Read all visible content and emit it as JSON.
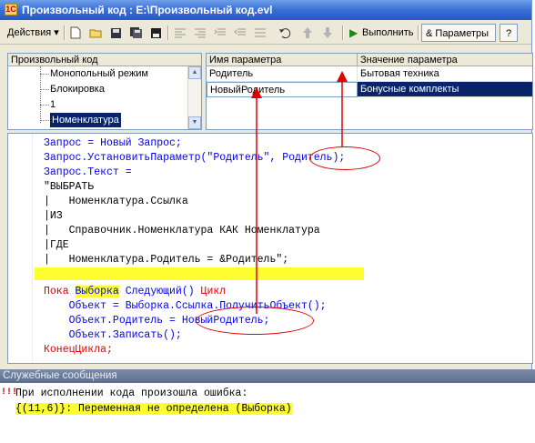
{
  "window": {
    "title": "Произвольный код : E:\\Произвольный код.evl",
    "icon": "1c-app-icon"
  },
  "toolbar": {
    "actions_label": "Действия",
    "actions_arrow": "▾",
    "run_label": "Выполнить",
    "params_label": "Параметры",
    "params_prefix": "&",
    "help_label": "?",
    "icons": [
      "new-doc-icon",
      "open-folder-icon",
      "save-icon",
      "save-all-icon",
      "floppy-icon",
      "align-left-icon",
      "align-right-icon",
      "indent-icon",
      "unindent-icon",
      "list-icon",
      "undo-icon",
      "arrow-up-icon",
      "arrow-down-icon",
      "run-icon"
    ]
  },
  "left_pane": {
    "header": "Произвольный код",
    "items": [
      "Монопольный режим",
      "Блокировка",
      "1",
      "Номенклатура"
    ],
    "selected_index": 3
  },
  "params_grid": {
    "col1": "Имя параметра",
    "col2": "Значение параметра",
    "rows": [
      {
        "name": "Родитель",
        "value": "Бытовая техника"
      },
      {
        "name": "НовыйРодитель",
        "value": "Бонусные комплекты"
      }
    ]
  },
  "code": {
    "l1a": "Запрос = Новый Запрос;",
    "l2a": "Запрос.УстановитьПараметр(\"Родитель\", ",
    "l2b": "Родитель",
    "l2c": ");",
    "l3": "Запрос.Текст =",
    "l4": "\"ВЫБРАТЬ",
    "l5": "|   Номенклатура.Ссылка",
    "l6": "|ИЗ",
    "l7": "|   Справочник.Номенклатура КАК Номенклатура",
    "l8": "|ГДЕ",
    "l9": "|   Номенклатура.Родитель = &Родитель\";",
    "l10a": "Пока ",
    "l10b": "Выборка",
    "l10c": " Следующий()",
    "l10d": " Цикл",
    "l11": "    Объект = Выборка.Ссылка.ПолучитьОбъект();",
    "l12a": "    Объект.Родитель = ",
    "l12b": "НовыйРодитель",
    "l12c": ";",
    "l13": "    Объект.Записать();",
    "l14": "КонецЦикла;"
  },
  "messages": {
    "title": "Служебные сообщения",
    "line1": "При исполнении кода произошла ошибка:",
    "line2": "{(11,6)}: Переменная не определена (Выборка)",
    "icon": "error-marker-icon"
  },
  "colors": {
    "keyword": "#e00000",
    "identifier": "#0000ee",
    "highlight": "#ffff30",
    "selection": "#0a246a",
    "annotation": "#e00000"
  }
}
